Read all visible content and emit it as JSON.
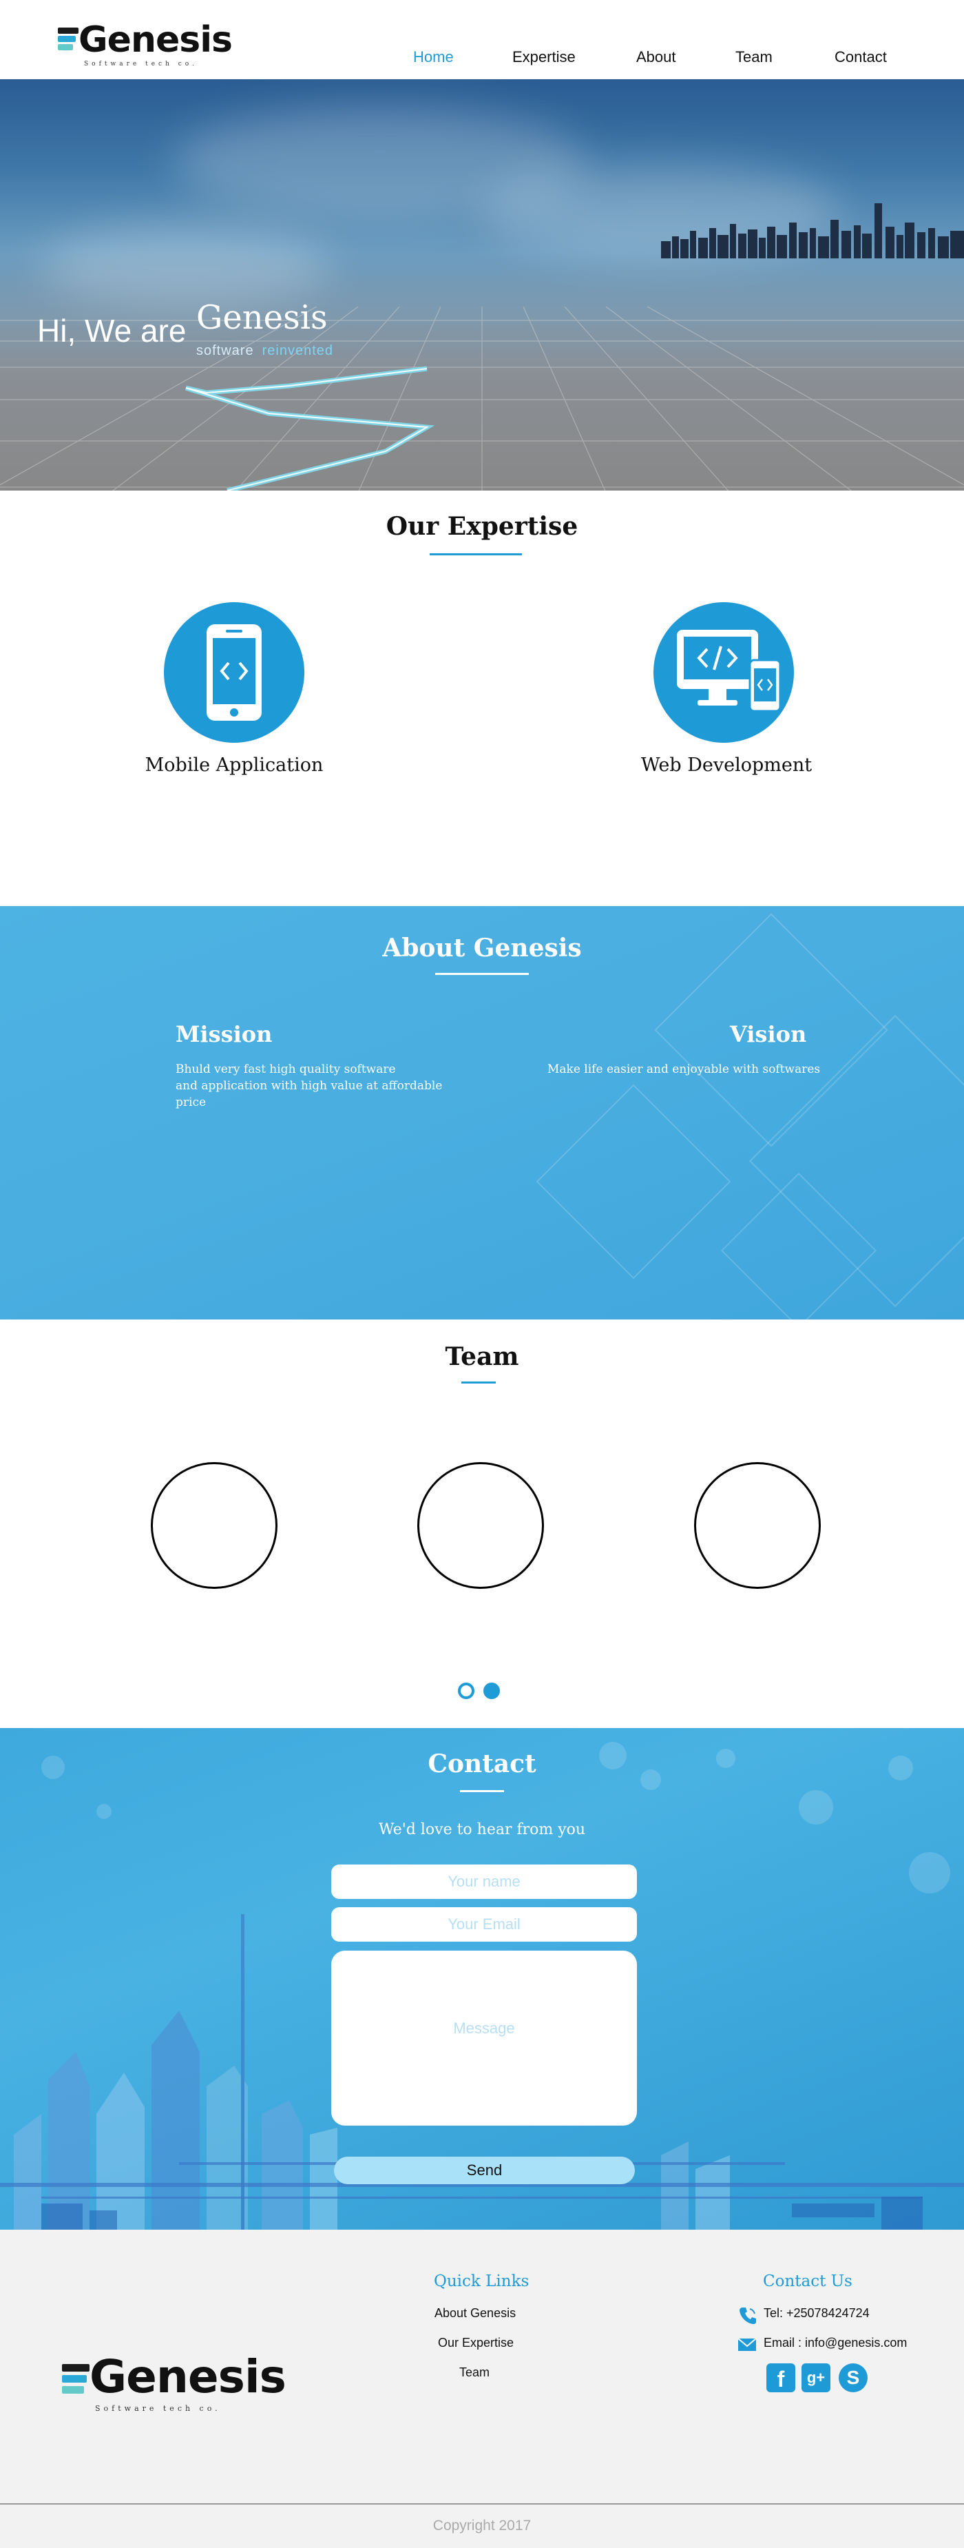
{
  "brand": {
    "name": "Genesis",
    "tagline": "Software tech co."
  },
  "nav": {
    "items": [
      {
        "label": "Home",
        "active": true
      },
      {
        "label": "Expertise",
        "active": false
      },
      {
        "label": "About",
        "active": false
      },
      {
        "label": "Team",
        "active": false
      },
      {
        "label": "Contact",
        "active": false
      }
    ],
    "active_color": "#1f9bd7"
  },
  "hero": {
    "greeting": "Hi, We are",
    "brand": "Genesis",
    "sub_word_1": "software",
    "sub_word_2": "reinvented"
  },
  "expertise": {
    "title": "Our Expertise",
    "items": [
      {
        "label": "Mobile Application",
        "icon": "mobile-phone-code-icon"
      },
      {
        "label": "Web Development",
        "icon": "desktop-code-icon"
      }
    ]
  },
  "about": {
    "title": "About Genesis",
    "mission": {
      "heading": "Mission",
      "line1": "Bhuld  very fast high quality software",
      "line2": "and application with high value at affordable",
      "line3": "price"
    },
    "vision": {
      "heading": "Vision",
      "text": "Make life easier and enjoyable with softwares"
    }
  },
  "team": {
    "title": "Team",
    "carousel_page": 2,
    "carousel_pages": 2
  },
  "contact": {
    "title": "Contact",
    "subtitle": "We'd love to hear from you",
    "name_placeholder": "Your name",
    "email_placeholder": "Your Email",
    "message_placeholder": "Message",
    "send_label": "Send"
  },
  "footer": {
    "quick_links": {
      "heading": "Quick Links",
      "items": [
        "About Genesis",
        "Our Expertise",
        "Team"
      ]
    },
    "contact_us": {
      "heading": "Contact Us",
      "phone": "Tel: +25078424724",
      "email": "Email : info@genesis.com"
    },
    "social": [
      "facebook-icon",
      "google-plus-icon",
      "skype-icon"
    ],
    "copyright": "Copyright 2017"
  },
  "colors": {
    "accent": "#1f9bd7",
    "about_bg": "#4aaee0",
    "footer_bg": "#f2f2f2"
  }
}
